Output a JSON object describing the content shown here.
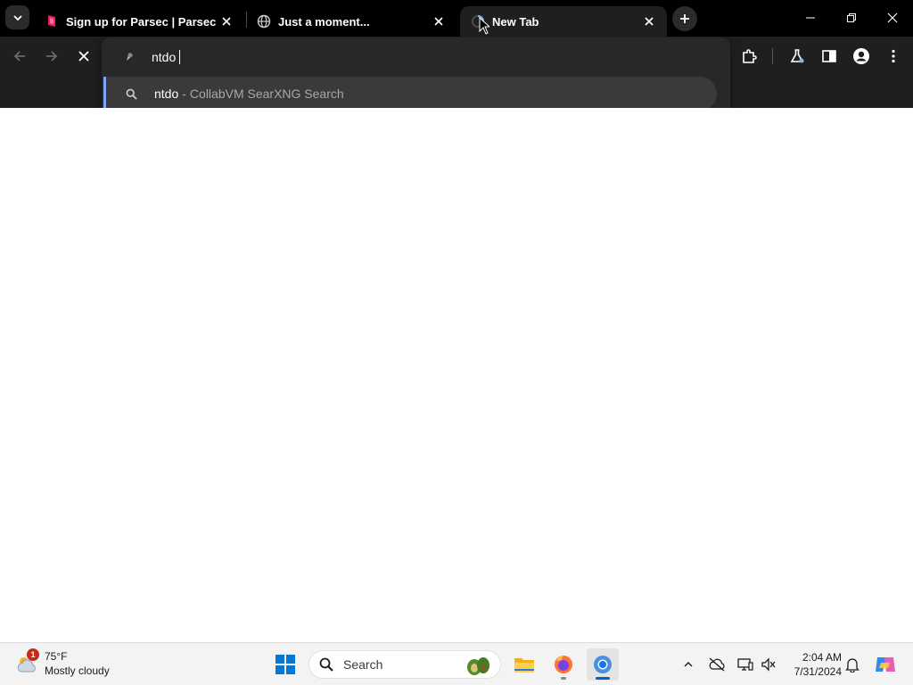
{
  "browser": {
    "tabs": [
      {
        "title": "Sign up for Parsec | Parsec",
        "favicon": "parsec-logo-icon",
        "active": false
      },
      {
        "title": "Just a moment...",
        "favicon": "globe-icon",
        "active": false
      },
      {
        "title": "New Tab",
        "favicon": "loading-spinner-icon",
        "active": true
      }
    ],
    "omnibox": {
      "value": "ntdo",
      "suggestion": {
        "query": "ntdo",
        "separator": "-",
        "description": "CollabVM SearXNG Search"
      }
    },
    "colors": {
      "tabstrip": "#000000",
      "toolbar": "#1f1f1f",
      "omnibox": "#282828",
      "accent": "#7ba7ff"
    }
  },
  "taskbar": {
    "weather": {
      "badge": "1",
      "temp": "75°F",
      "condition": "Mostly cloudy"
    },
    "search_label": "Search",
    "clock": {
      "time": "2:04 AM",
      "date": "7/31/2024"
    }
  }
}
